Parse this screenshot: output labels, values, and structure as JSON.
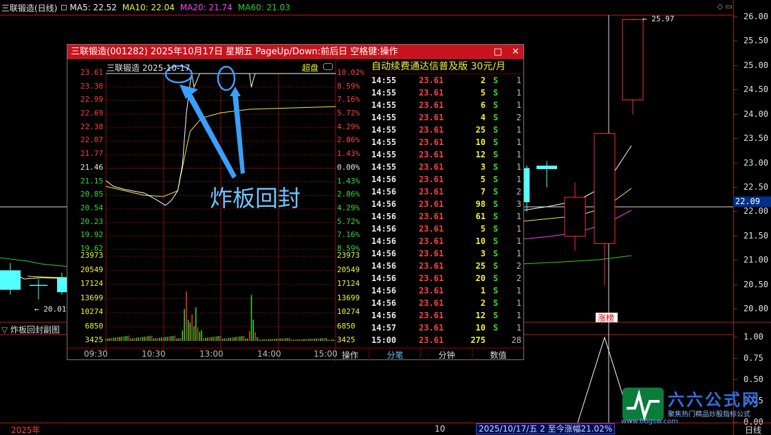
{
  "main": {
    "title": "三联锻造(日线)",
    "ma5": "MA5: 22.52",
    "ma10": "MA10: 22.04",
    "ma20": "MA20: 21.74",
    "ma60": "MA60: 21.03",
    "icons": "◇ ▭",
    "y_ticks": [
      "26.00",
      "25.50",
      "25.00",
      "24.50",
      "24.00",
      "23.50",
      "23.00",
      "22.50",
      "22.00",
      "21.50",
      "21.00",
      "20.50",
      "20.00"
    ],
    "price_tag": "22.09",
    "high_label": "25.97",
    "low_label": "20.01",
    "limit_badge": "涨榜",
    "sub_title": "炸板回封副图",
    "sub_y_ticks": [
      "1.00",
      "0.75",
      "0.50",
      "0.25",
      "0.00"
    ],
    "year_label": "2025年",
    "bottom_num": "10",
    "bottom_info": "2025/10/17/五 2 至今涨幅21.02%",
    "period": "日线",
    "colors": {
      "up": "#ff3030",
      "down": "#54ffff",
      "ma5": "#ffffff",
      "ma10": "#f2f23a",
      "ma20": "#ff40ff",
      "ma60": "#2ed22e",
      "grid": "#c41d1d"
    }
  },
  "popup": {
    "title": "三联锻造(001282) 2025年10月17日 星期五 PageUp/Down:前后日 空格键:操作",
    "buttons": [
      "□",
      "✕"
    ],
    "chart_header": "三联锻造    2025-10-17",
    "chaopan": "超盘",
    "price_ticks": [
      "23.61",
      "23.30",
      "22.99",
      "22.69",
      "22.38",
      "22.07",
      "21.77",
      "21.46",
      "21.15",
      "20.85",
      "20.54",
      "20.23",
      "19.92",
      "19.62"
    ],
    "pct_ticks": [
      "10.02%",
      "8.59%",
      "7.16%",
      "5.72%",
      "4.29%",
      "2.86%",
      "1.43%",
      "0.00%",
      "1.43%",
      "2.86%",
      "4.29%",
      "5.72%",
      "7.16%",
      "8.59%"
    ],
    "vol_ticks": [
      "23973",
      "20549",
      "17124",
      "13699",
      "10274",
      "6850",
      "3425"
    ],
    "time_ticks": [
      "09:30",
      "10:30",
      "13:00",
      "14:00",
      "15:00"
    ],
    "annotation": "炸板回封",
    "table_banner": "自动续费通达信普及版  30元/月",
    "ticks": [
      {
        "t": "14:55",
        "p": "23.61",
        "v": "2",
        "s": "S",
        "n": "1"
      },
      {
        "t": "14:55",
        "p": "23.61",
        "v": "5",
        "s": "S",
        "n": "1"
      },
      {
        "t": "14:55",
        "p": "23.61",
        "v": "6",
        "s": "S",
        "n": "1"
      },
      {
        "t": "14:55",
        "p": "23.61",
        "v": "4",
        "s": "S",
        "n": "2"
      },
      {
        "t": "14:55",
        "p": "23.61",
        "v": "25",
        "s": "S",
        "n": "1"
      },
      {
        "t": "14:55",
        "p": "23.61",
        "v": "10",
        "s": "S",
        "n": "1"
      },
      {
        "t": "14:55",
        "p": "23.61",
        "v": "12",
        "s": "S",
        "n": "1"
      },
      {
        "t": "14:55",
        "p": "23.61",
        "v": "3",
        "s": "S",
        "n": "1"
      },
      {
        "t": "14:56",
        "p": "23.61",
        "v": "5",
        "s": "S",
        "n": "1"
      },
      {
        "t": "14:56",
        "p": "23.61",
        "v": "7",
        "s": "S",
        "n": "2"
      },
      {
        "t": "14:56",
        "p": "23.61",
        "v": "98",
        "s": "S",
        "n": "3"
      },
      {
        "t": "14:56",
        "p": "23.61",
        "v": "61",
        "s": "S",
        "n": "1"
      },
      {
        "t": "14:56",
        "p": "23.61",
        "v": "5",
        "s": "S",
        "n": "1"
      },
      {
        "t": "14:56",
        "p": "23.61",
        "v": "10",
        "s": "S",
        "n": "1"
      },
      {
        "t": "14:56",
        "p": "23.61",
        "v": "3",
        "s": "S",
        "n": "1"
      },
      {
        "t": "14:56",
        "p": "23.61",
        "v": "25",
        "s": "S",
        "n": "2"
      },
      {
        "t": "14:56",
        "p": "23.61",
        "v": "20",
        "s": "S",
        "n": "2"
      },
      {
        "t": "14:56",
        "p": "23.61",
        "v": "1",
        "s": "S",
        "n": "1"
      },
      {
        "t": "14:56",
        "p": "23.61",
        "v": "2",
        "s": "S",
        "n": "1"
      },
      {
        "t": "14:56",
        "p": "23.61",
        "v": "12",
        "s": "S",
        "n": "1"
      },
      {
        "t": "14:57",
        "p": "23.61",
        "v": "10",
        "s": "S",
        "n": "1"
      },
      {
        "t": "15:00",
        "p": "23.61",
        "v": "275",
        "s": "",
        "n": "28"
      }
    ],
    "tabs": [
      "操作",
      "分笔",
      "分钟",
      "数值"
    ]
  },
  "watermark": {
    "brand": "六六公式网",
    "slogan": "聚焦热门精品炒股指标公式",
    "url": "www.66gsw.com"
  }
}
